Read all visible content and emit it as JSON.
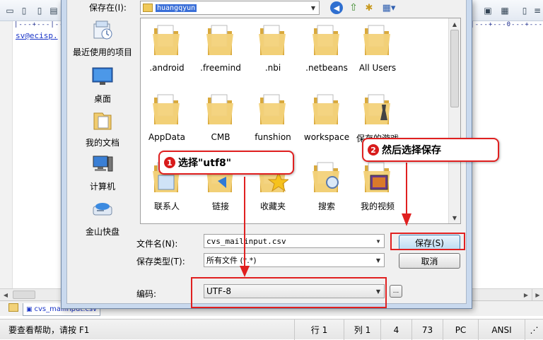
{
  "editor": {
    "ruler_text": "|---+---|---+---|---+---|---+---|---+---|---+---|---+---|---+---|---+---|---+---|---+---|---+---|---+---|---+---|---+---|---+---|---+---|---+---|---+---|---+---0---+---",
    "code_line": "sv@ecisp.",
    "file_tab": "cvs_mailinput.csv",
    "status": {
      "help": "要查看帮助，请按 F1",
      "line": "行 1",
      "col": "列 1",
      "v1": "4",
      "v2": "73",
      "eol": "PC",
      "enc": "ANSI"
    }
  },
  "dialog": {
    "save_in_label": "保存在(I):",
    "save_in_value": "huangqyun",
    "places": [
      {
        "label": "最近使用的项目",
        "icon": "recent-icon"
      },
      {
        "label": "桌面",
        "icon": "desktop-icon"
      },
      {
        "label": "我的文档",
        "icon": "documents-icon"
      },
      {
        "label": "计算机",
        "icon": "computer-icon"
      },
      {
        "label": "金山快盘",
        "icon": "kuaipan-icon"
      }
    ],
    "files": [
      {
        "label": ".android",
        "kind": "folder"
      },
      {
        "label": ".freemind",
        "kind": "folder"
      },
      {
        "label": ".nbi",
        "kind": "folder"
      },
      {
        "label": ".netbeans",
        "kind": "folder"
      },
      {
        "label": "All Users",
        "kind": "folder"
      },
      {
        "label": "AppData",
        "kind": "folder"
      },
      {
        "label": "CMB",
        "kind": "folder"
      },
      {
        "label": "funshion",
        "kind": "folder"
      },
      {
        "label": "workspace",
        "kind": "folder"
      },
      {
        "label": "保存的游戏",
        "kind": "games"
      },
      {
        "label": "联系人",
        "kind": "contacts"
      },
      {
        "label": "链接",
        "kind": "links"
      },
      {
        "label": "收藏夹",
        "kind": "favorites"
      },
      {
        "label": "搜索",
        "kind": "search"
      },
      {
        "label": "我的视频",
        "kind": "videos"
      }
    ],
    "filename_label": "文件名(N):",
    "filename_value": "cvs_mailinput.csv",
    "filetype_label": "保存类型(T):",
    "filetype_value": "所有文件 (*.*)",
    "encoding_label": "编码:",
    "encoding_value": "UTF-8",
    "save_button": "保存(S)",
    "cancel_button": "取消",
    "more_button": "..."
  },
  "annotations": {
    "step1_number": "1",
    "step1_text": "选择\"utf8\"",
    "step2_number": "2",
    "step2_text": "然后选择保存",
    "color": "#e02020"
  }
}
